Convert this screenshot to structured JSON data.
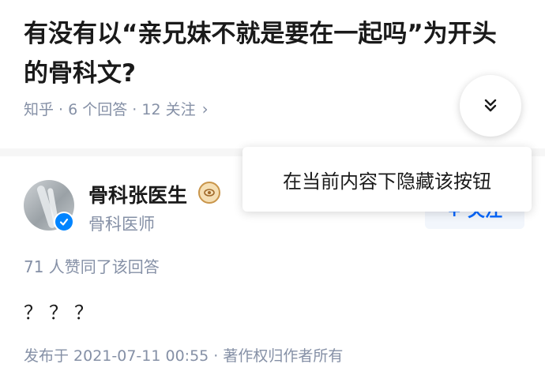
{
  "question": {
    "title": "有没有以“亲兄妹不就是要在一起吗”为开头的骨科文?",
    "meta": "知乎 · 6 个回答 · 12 关注",
    "meta_chevron": "›"
  },
  "collapse_button": {
    "icon": "double-chevron-down-icon"
  },
  "popup": {
    "text": "在当前内容下隐藏该按钮"
  },
  "answer": {
    "author_name": "骨科张医生",
    "author_title": "骨科医师",
    "follow_label": "+ 关注",
    "vote_text": "71 人赞同了该回答",
    "body": "？？？",
    "publish_info": "发布于 2021-07-11 00:55 · 著作权归作者所有"
  },
  "colors": {
    "accent": "#0084ff",
    "meta_text": "#8590a6",
    "follow_text": "#0066ff",
    "follow_bg": "#f2f6fc"
  }
}
